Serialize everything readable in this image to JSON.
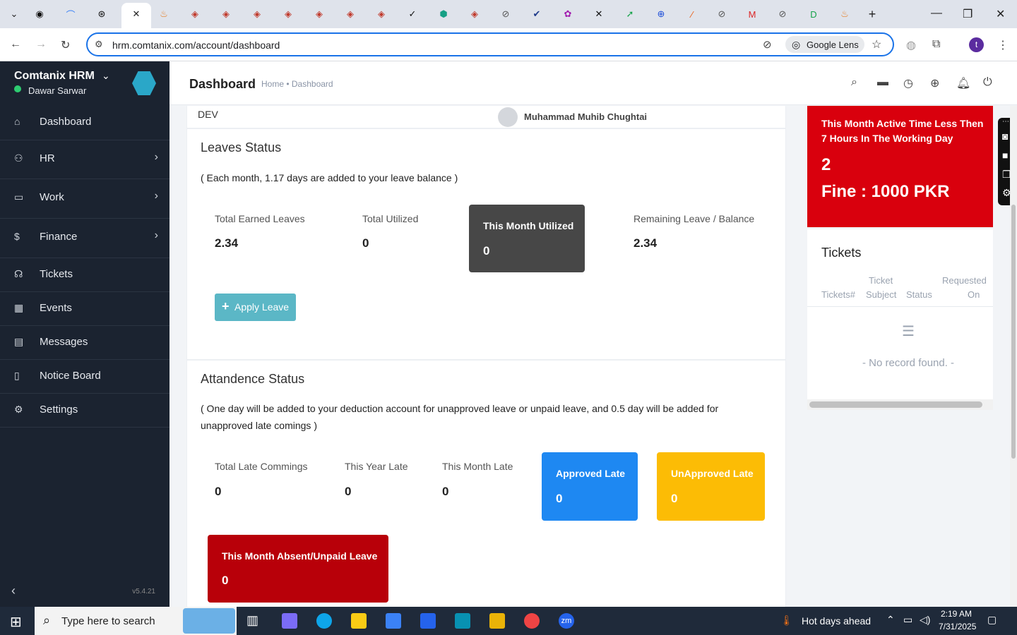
{
  "browser": {
    "url": "hrm.comtanix.com/account/dashboard",
    "lens_label": "Google Lens",
    "profile_initial": "t"
  },
  "sidebar": {
    "brand": "Comtanix HRM",
    "user": "Dawar Sarwar",
    "items": [
      {
        "label": "Dashboard",
        "icon": "home-icon"
      },
      {
        "label": "HR",
        "icon": "users-icon"
      },
      {
        "label": "Work",
        "icon": "briefcase-icon"
      },
      {
        "label": "Finance",
        "icon": "dollar-icon"
      },
      {
        "label": "Tickets",
        "icon": "headset-icon"
      },
      {
        "label": "Events",
        "icon": "calendar-icon"
      },
      {
        "label": "Messages",
        "icon": "message-icon"
      },
      {
        "label": "Notice Board",
        "icon": "clipboard-icon"
      },
      {
        "label": "Settings",
        "icon": "gear-icon"
      }
    ],
    "version": "v5.4.21"
  },
  "header": {
    "title": "Dashboard",
    "breadcrumb": "Home • Dashboard"
  },
  "top_strip": {
    "dept": "DEV",
    "person": "Muhammad Muhib Chughtai"
  },
  "leaves": {
    "title": "Leaves Status",
    "note": "( Each month, 1.17 days are added to your leave balance )",
    "total_earned_label": "Total Earned Leaves",
    "total_earned": "2.34",
    "total_utilized_label": "Total Utilized",
    "total_utilized": "0",
    "month_utilized_label": "This Month Utilized",
    "month_utilized": "0",
    "remaining_label": "Remaining Leave / Balance",
    "remaining": "2.34",
    "apply_label": "Apply Leave"
  },
  "attendance": {
    "title": "Attandence Status",
    "note_line1": "( One day will be added to your deduction account for unapproved leave or unpaid leave, and 0.5 day will be added for",
    "note_line2": "unapproved late comings )",
    "total_late_label": "Total Late Commings",
    "total_late": "0",
    "year_late_label": "This Year Late",
    "year_late": "0",
    "month_late_label": "This Month Late",
    "month_late": "0",
    "approved_label": "Approved Late",
    "approved": "0",
    "unapproved_label": "UnApproved Late",
    "unapproved": "0",
    "absent_label": "This Month Absent/Unpaid Leave",
    "absent": "0"
  },
  "fine_card": {
    "line1": "This Month Active Time Less Then",
    "line2": "7 Hours In The Working Day",
    "count": "2",
    "fine": "Fine : 1000 PKR"
  },
  "tickets": {
    "title": "Tickets",
    "col1": "Tickets#",
    "col2a": "Ticket",
    "col2b": "Subject",
    "col3": "Status",
    "col4a": "Requested",
    "col4b": "On",
    "empty": "- No record found. -"
  },
  "taskbar": {
    "search_placeholder": "Type here to search",
    "weather": "Hot days ahead",
    "time": "2:19 AM",
    "date": "7/31/2025"
  },
  "colors": {
    "sidebar_bg": "#1b2330",
    "dark_box": "#474747",
    "blue_box": "#1e88f2",
    "yellow_box": "#fcbc05",
    "red_box": "#b80009",
    "fine_red": "#d9000d",
    "apply_teal": "#5bb7c6"
  }
}
